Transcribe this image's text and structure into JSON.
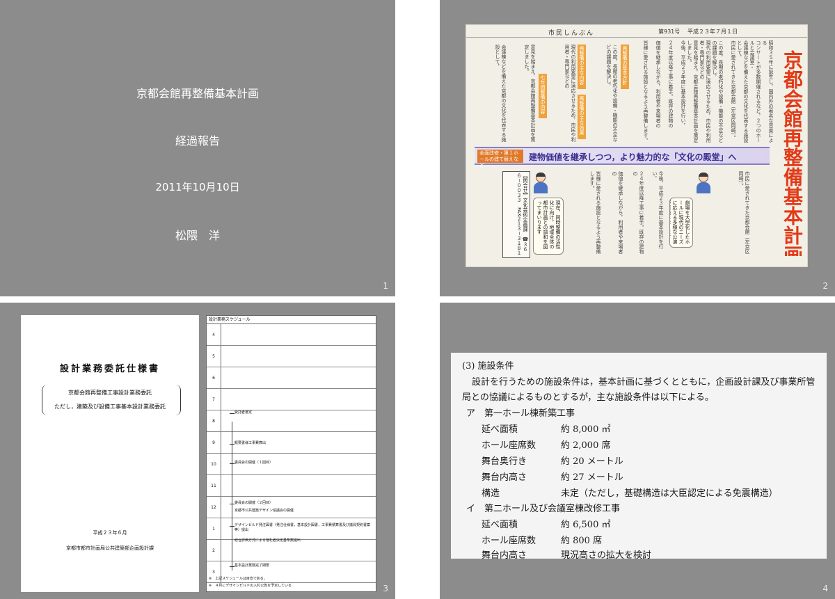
{
  "slides": {
    "s1": {
      "title": "京都会館再整備基本計画",
      "subtitle": "経過報告",
      "date": "2011年10月10日",
      "author": "松隈　洋",
      "number": "1"
    },
    "s2": {
      "number": "2",
      "masthead": "市民しんぶん",
      "issue": "第931号",
      "issue_date": "平成２３年７月１日",
      "headline": "京都会館再整備基本計画を策定",
      "banner_tag": "全面改修・第１ホールの建て替えなど",
      "banner_text": "建物価値を継承しつつ，より魅力的な「文化の殿堂」へ",
      "col1": "昭和３５年に誕生し，国内外の著名な音楽による",
      "col2": "コンサートが多数開催されるなど，２つのホールと会議室・",
      "col3": "会議棟などを備えた京都の文化を代表する施設として，",
      "col4": "市民に愛されてきた京都会館（左京区岡崎）。",
      "col5": "この度，長期の老朽化や設備・機能の不足などの課題を解決し，",
      "col6": "現代の利用要望に適応させるため，市民や利用者・専門家などの",
      "col7": "意見を踏まえ，京都会館再整備基本計画を策定しました。",
      "col8": "今後，平成２３年度に基本設計を行い，",
      "col9": "２４年度以降工事に着手。既存の建物の",
      "col10": "価値を継承しながら，利用者や来場者の",
      "col11": "皆様に愛される施設となるよう再整備します。",
      "sec1": "再整備の基本方針",
      "sec2": "再整備の主な内容",
      "sec3": "再整備の主な効果",
      "sec4": "七年間整備の内容",
      "speech1": "劇場を大型化したホールに現代のニーズに応える多様な公演が可能になります",
      "speech2": "現在，同時整備の活性化に向け，地域全体の都市計画との調和を図ってまいります",
      "contact": "【問合せ】文化芸術企画課　☎３６６－００３３　FAX２１３－３１８１"
    },
    "s3": {
      "number": "3",
      "cover_title": "設計業務委託仕様書",
      "cover_sub1": "京都会館再整備工事設計業務委託",
      "cover_sub2": "ただし，建築及び設備工事基本設計業務委託",
      "cover_date": "平成２３年６月",
      "cover_org": "京都市都市計画局公共建築部企画設計課",
      "schedule_title": "設計業務スケジュール",
      "months": [
        "4",
        "5",
        "6",
        "7",
        "8",
        "9",
        "10",
        "11",
        "12",
        "1",
        "2",
        "3"
      ],
      "events": [
        "受託者選定",
        "概要書様工事費算出",
        "委員会の開催（１回目）",
        "委員会の開催（２回目）",
        "京都市公共建築デザイン協議会の開催",
        "デザインビルド発注図書（発注仕様書，基本設計図書，工事費積算書及び議員契約書案等）提出",
        "総合評価方式による落札者決定基準案提出",
        "基本設計業務完了期限"
      ],
      "notes": [
        "※　上記スケジュールは目安である。",
        "※　４月にデザインビルドの入札公告を予定している"
      ]
    },
    "s4": {
      "number": "4",
      "heading": "(3)  施設条件",
      "para1": "設計を行うための施設条件は，基本計画に基づくとともに，企画設計課及び事業所管",
      "para2": "局との協議によるものとするが，主な施設条件は以下による。",
      "sectionA": "ア　第一ホール棟新築工事",
      "a_rows": [
        {
          "k": "延べ面積",
          "v": "約 8,000 ㎡"
        },
        {
          "k": "ホール座席数",
          "v": "約 2,000 席"
        },
        {
          "k": "舞台奥行き",
          "v": "約 20 メートル"
        },
        {
          "k": "舞台内高さ",
          "v": "約 27 メートル"
        },
        {
          "k": "構造",
          "v": "未定（ただし，基礎構造は大臣認定による免震構造）"
        }
      ],
      "sectionB": "イ　第二ホール及び会議室棟改修工事",
      "b_rows": [
        {
          "k": "延べ面積",
          "v": "約 6,500 ㎡"
        },
        {
          "k": "ホール座席数",
          "v": "約 800 席"
        },
        {
          "k": "舞台内高さ",
          "v": "現況高さの拡大を検討"
        }
      ]
    }
  },
  "colors": {
    "slide_bg": "#8c8c8c",
    "headline_red": "#e23a17",
    "banner_purple": "#3b2f8f",
    "label_orange": "#f0a23a"
  }
}
